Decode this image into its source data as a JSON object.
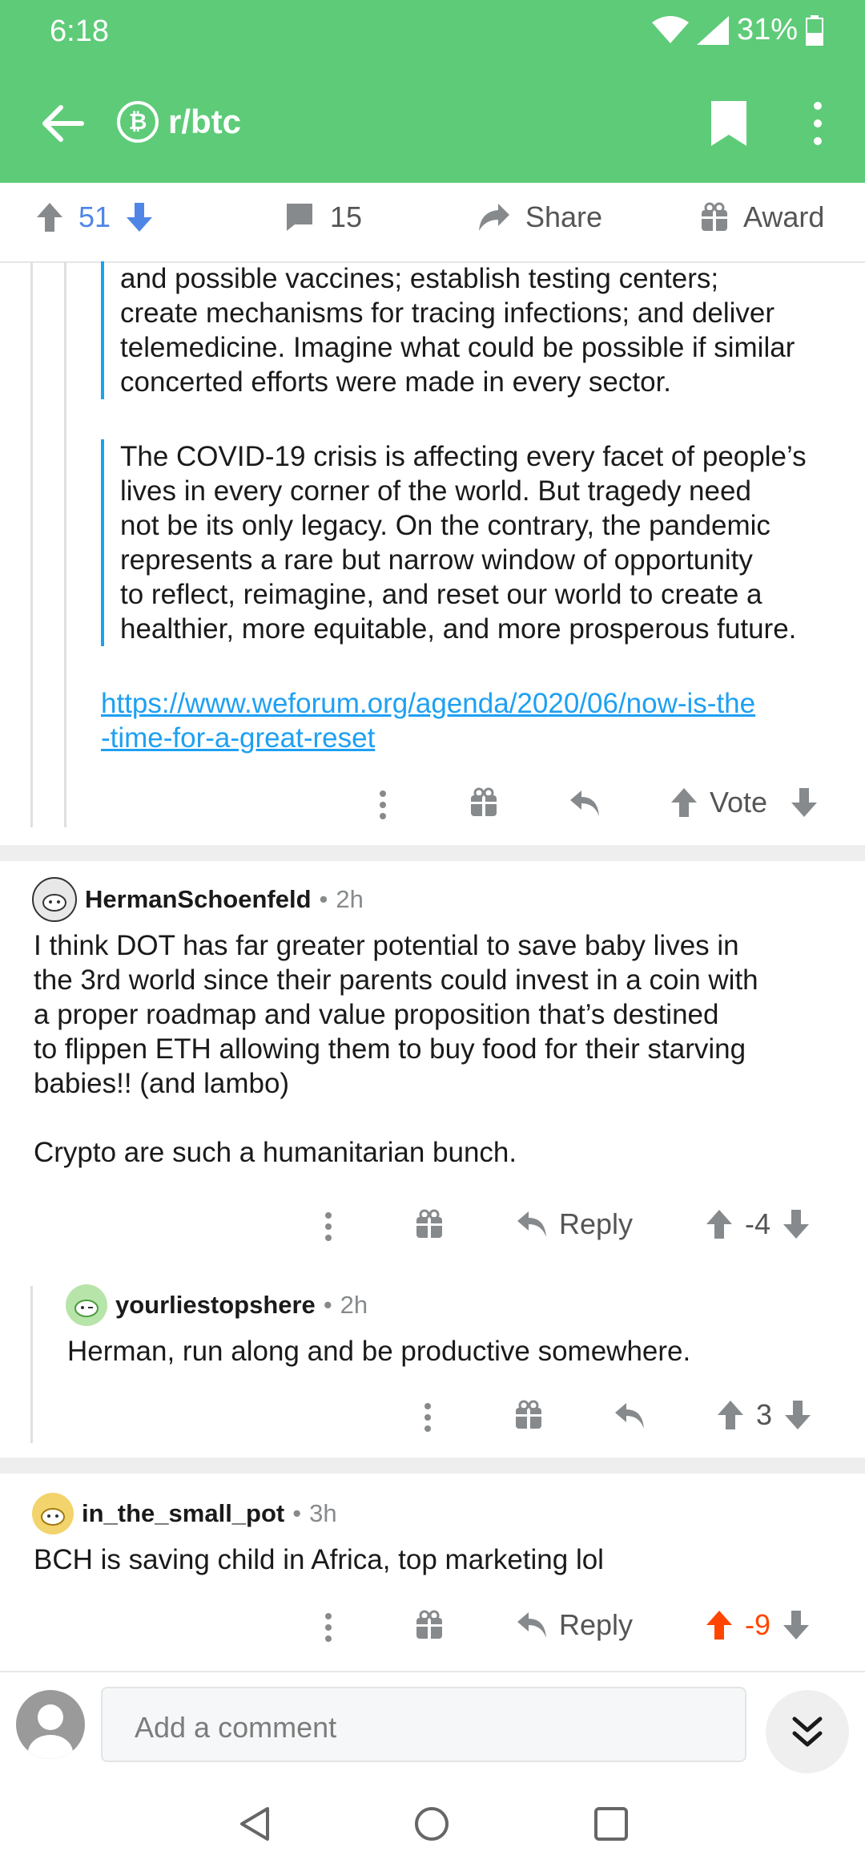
{
  "status": {
    "time": "6:18",
    "battery": "31%"
  },
  "appbar": {
    "subreddit": "r/btc",
    "sub_icon_letter": "₿"
  },
  "post_actions": {
    "score": "51",
    "comments": "15",
    "share": "Share",
    "award": "Award"
  },
  "quote1": [
    "and possible vaccines; establish testing centers;",
    "create mechanisms for tracing infections; and deliver",
    "telemedicine. Imagine what could be possible if similar",
    "concerted efforts were made in every sector."
  ],
  "quote2": [
    "The COVID-19 crisis is affecting every facet of people’s",
    "lives in every corner of the world. But tragedy need",
    "not be its only legacy. On the contrary, the pandemic",
    "represents a rare but narrow window of opportunity",
    "to reflect, reimagine, and reset our world to create a",
    "healthier, more equitable, and more prosperous future."
  ],
  "link": {
    "line1": "https://www.weforum.org/agenda/2020/06/now-is-the",
    "line2": "-time-for-a-great-reset"
  },
  "first_actions": {
    "vote": "Vote"
  },
  "comments": [
    {
      "author": "HermanSchoenfeld",
      "age": "2h",
      "body1": [
        "I think DOT has far greater potential to save baby lives in",
        "the 3rd world since their parents could invest in a coin with",
        "a proper roadmap and value proposition that’s destined",
        "to flippen ETH allowing them to buy food for their starving",
        "babies!! (and lambo)"
      ],
      "body2": "Crypto are such a humanitarian bunch.",
      "reply": "Reply",
      "score": "-4"
    },
    {
      "author": "yourliestopshere",
      "age": "2h",
      "body": "Herman, run along and be productive somewhere.",
      "score": "3"
    },
    {
      "author": "in_the_small_pot",
      "age": "3h",
      "body": "BCH is saving child in Africa, top marketing lol",
      "reply": "Reply",
      "score": "-9"
    }
  ],
  "composer": {
    "placeholder": "Add a comment"
  },
  "colors": {
    "header": "#5ecb78",
    "upvote_blue": "#4f86e6",
    "link": "#1ea0f2",
    "orange": "#ff4500"
  }
}
